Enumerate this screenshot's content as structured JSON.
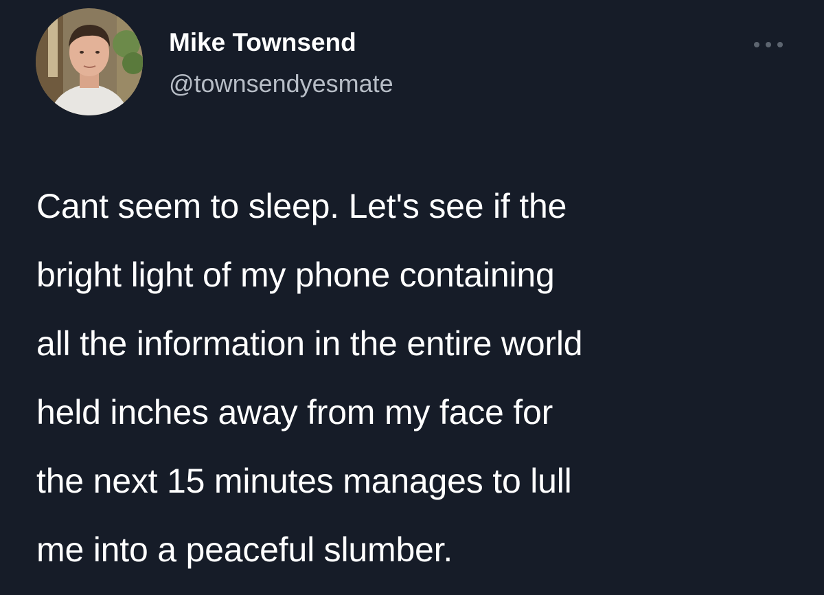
{
  "author": {
    "name": "Mike Townsend",
    "handle": "@townsendyesmate",
    "avatar_icon": "profile-photo"
  },
  "menu": {
    "icon": "more-options-icon"
  },
  "tweet": {
    "lines": [
      "Cant seem to sleep. Let's see if the",
      "bright light of my phone containing",
      "all the information in the entire world",
      "held inches away from my face for",
      "the next 15 minutes manages to lull",
      "me into a peaceful slumber."
    ]
  },
  "colors": {
    "background": "#161c28",
    "name": "#ffffff",
    "handle": "#b7bdc6",
    "text": "#ffffff",
    "menu_dots": "#5d6570"
  }
}
